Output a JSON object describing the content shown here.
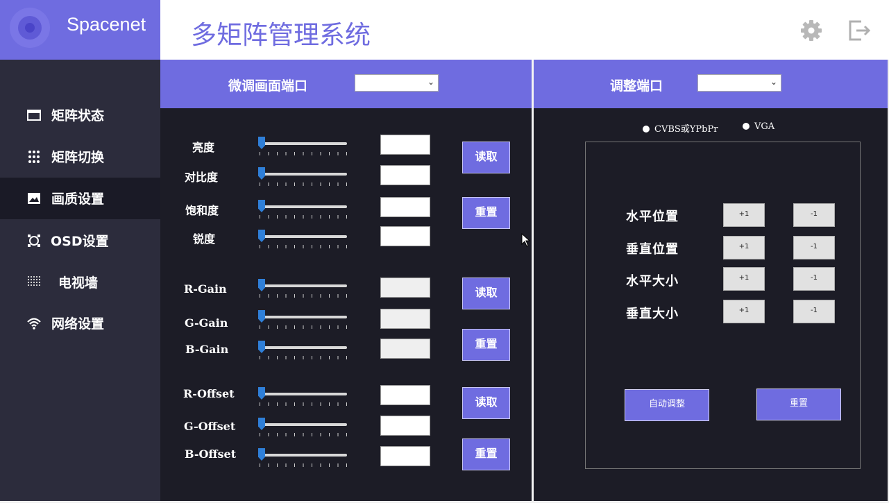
{
  "brand": {
    "name": "Spacenet"
  },
  "header": {
    "title": "多矩阵管理系统",
    "icons": [
      "gear-icon",
      "logout-icon"
    ]
  },
  "sidebar": {
    "items": [
      {
        "label": "矩阵状态",
        "icon": "window-icon"
      },
      {
        "label": "矩阵切换",
        "icon": "grid-dots-icon"
      },
      {
        "label": "画质设置",
        "icon": "image-icon",
        "active": true
      },
      {
        "label": "OSD设置",
        "icon": "osd-icon"
      },
      {
        "label": "电视墙",
        "icon": "video-wall-icon"
      },
      {
        "label": "网络设置",
        "icon": "wifi-icon"
      }
    ]
  },
  "left_panel": {
    "title": "微调画面端口",
    "select_value": "",
    "params": [
      {
        "label": "亮度",
        "value": ""
      },
      {
        "label": "对比度",
        "value": ""
      },
      {
        "label": "饱和度",
        "value": ""
      },
      {
        "label": "锐度",
        "value": ""
      },
      {
        "label": "R-Gain",
        "value": ""
      },
      {
        "label": "G-Gain",
        "value": ""
      },
      {
        "label": "B-Gain",
        "value": ""
      },
      {
        "label": "R-Offset",
        "value": ""
      },
      {
        "label": "G-Offset",
        "value": ""
      },
      {
        "label": "B-Offset",
        "value": ""
      }
    ],
    "read_label": "读取",
    "reset_label": "重置"
  },
  "right_panel": {
    "title": "调整端口",
    "select_value": "",
    "radios": [
      "CVBS或YPbPr",
      "VGA"
    ],
    "rows": [
      "水平位置",
      "垂直位置",
      "水平大小",
      "垂直大小"
    ],
    "plus_label": "+1",
    "minus_label": "-1",
    "auto_adjust_label": "自动调整",
    "reset_label": "重置"
  },
  "colors": {
    "accent": "#6f6ce0",
    "panel_bg": "#1c1c26",
    "sidebar_bg": "#2c2c3c",
    "active_bg": "#1a1a26",
    "slider_thumb": "#2f7fd8"
  }
}
